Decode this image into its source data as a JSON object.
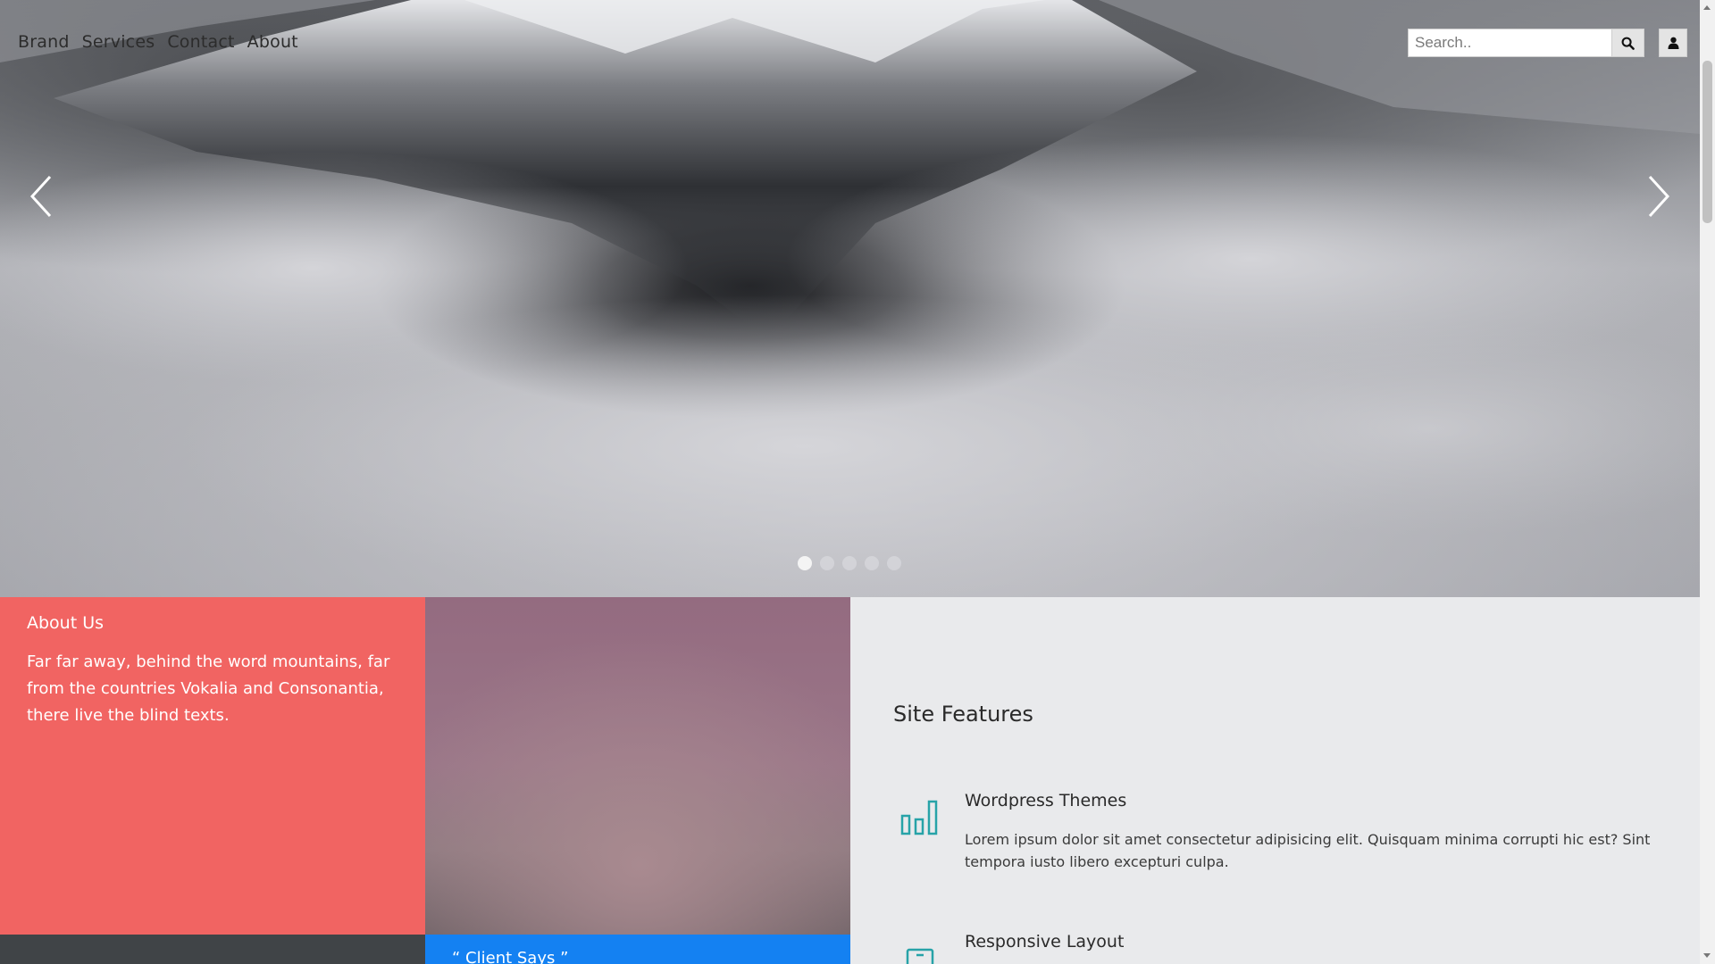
{
  "nav": {
    "items": [
      {
        "label": "Brand"
      },
      {
        "label": "Services"
      },
      {
        "label": "Contact"
      },
      {
        "label": "About"
      }
    ]
  },
  "search": {
    "placeholder": "Search..",
    "button_icon": "search-icon"
  },
  "user": {
    "icon": "user-icon"
  },
  "carousel": {
    "prev_icon": "chevron-left-icon",
    "next_icon": "chevron-right-icon",
    "slide_count": 5,
    "active_slide": 1
  },
  "about": {
    "title": "About Us",
    "text": "Far far away, behind the word mountains, far from the countries Vokalia and Consonantia, there live the blind texts."
  },
  "client": {
    "label": "“ Client Says ”"
  },
  "features": {
    "title": "Site Features",
    "items": [
      {
        "icon": "bar-chart-icon",
        "title": "Wordpress Themes",
        "text": "Lorem ipsum dolor sit amet consectetur adipisicing elit. Quisquam minima corrupti hic est? Sint tempora iusto libero excepturi culpa."
      },
      {
        "icon": "mobile-device-icon",
        "title": "Responsive Layout",
        "text": ""
      }
    ]
  },
  "colors": {
    "about_bg": "#f16462",
    "client_bg": "#1481f2",
    "feature_icon": "#27a3a8",
    "features_bg": "#e9eaec"
  }
}
